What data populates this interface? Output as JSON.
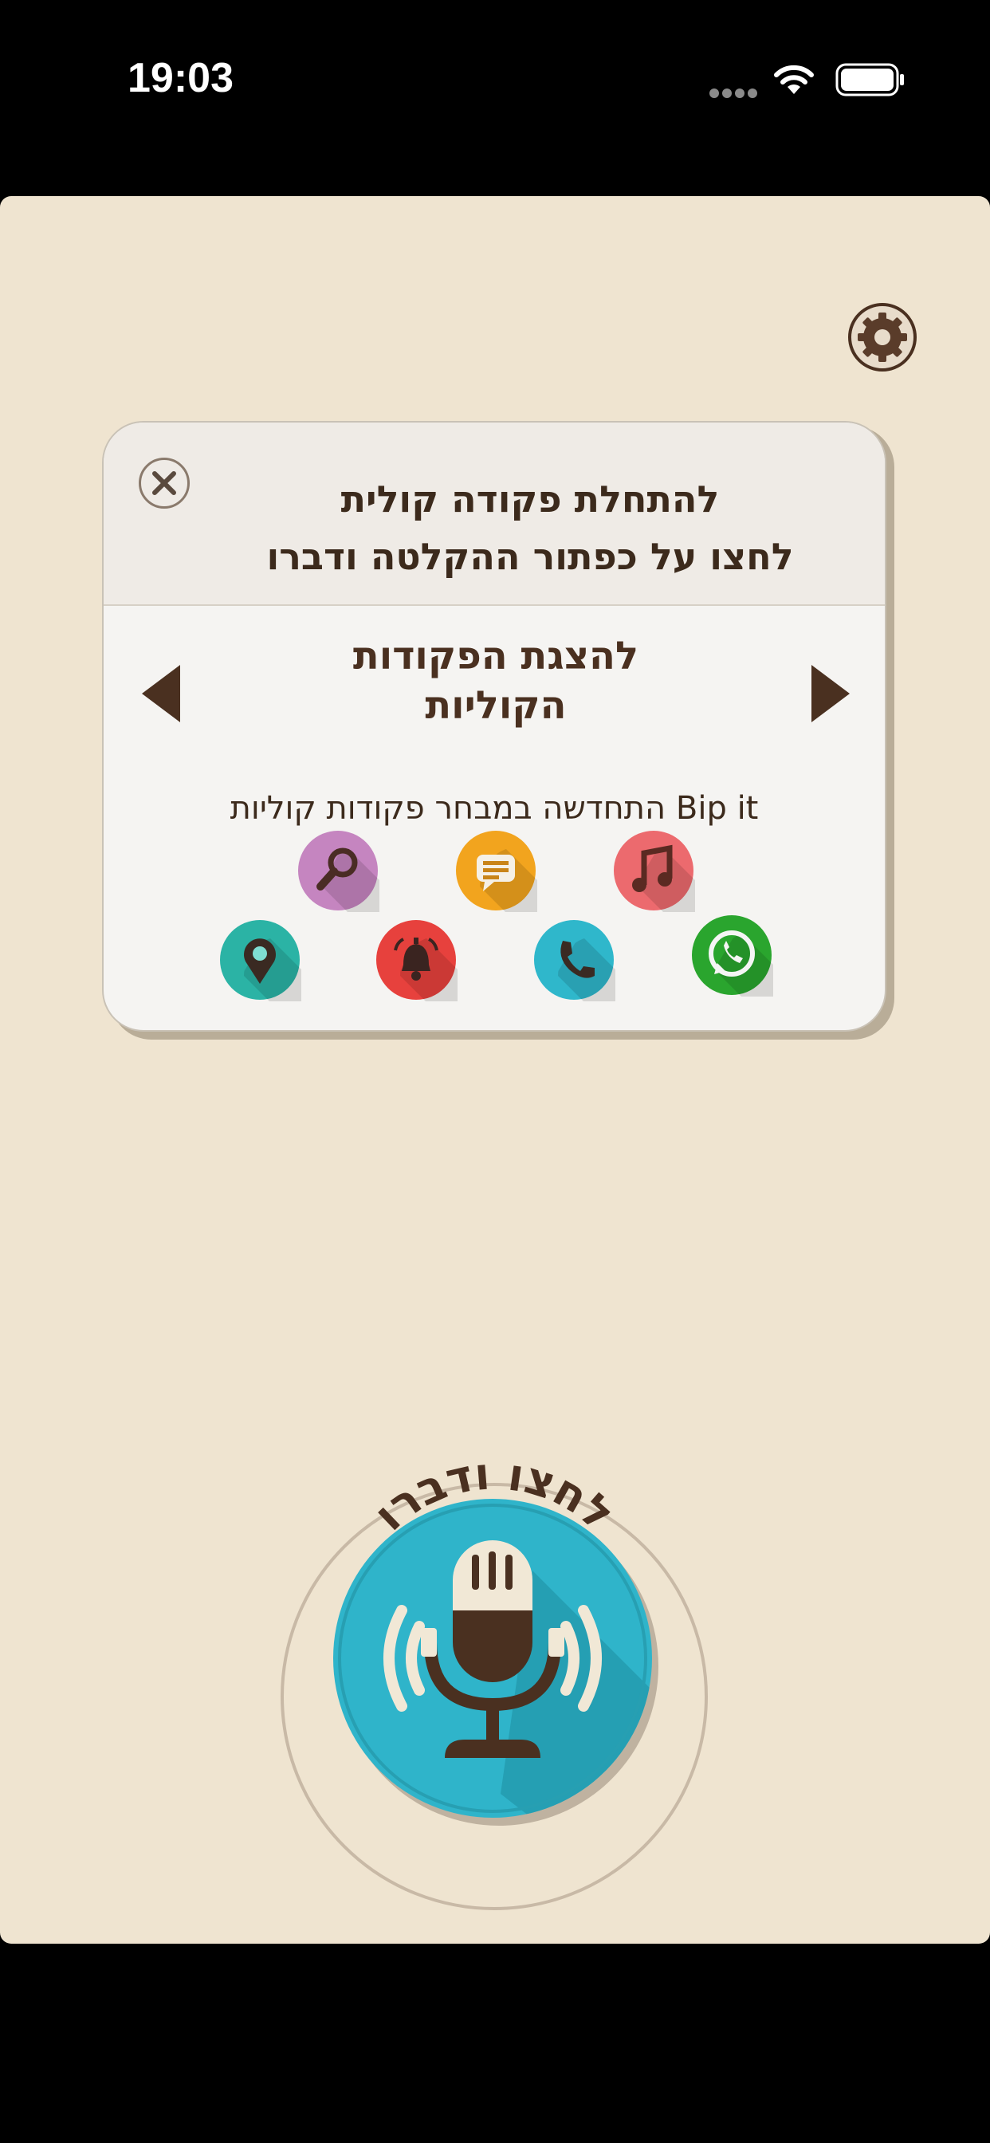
{
  "status_bar": {
    "time": "19:03"
  },
  "card": {
    "header_line1": "להתחלת פקודה קולית",
    "header_line2": "לחצו על כפתור ההקלטה ודברו",
    "slide_title_line1": "להצגת הפקודות",
    "slide_title_line2": "הקוליות",
    "slide_subtitle": "Bip it התחדשה במבחר פקודות קוליות",
    "icons": [
      {
        "name": "music-icon",
        "color": "#ec6a6e"
      },
      {
        "name": "message-icon",
        "color": "#f2a41e"
      },
      {
        "name": "search-icon",
        "color": "#c585c0"
      },
      {
        "name": "whatsapp-icon",
        "color": "#2aa52e"
      },
      {
        "name": "phone-icon",
        "color": "#2fb7cb"
      },
      {
        "name": "alarm-icon",
        "color": "#e7413d"
      },
      {
        "name": "location-icon",
        "color": "#2bb3a5"
      }
    ]
  },
  "mic": {
    "label": "לחצו ודברו",
    "color": "#2fb4ca"
  },
  "colors": {
    "background": "#efe4d0",
    "brown": "#4a3020"
  }
}
